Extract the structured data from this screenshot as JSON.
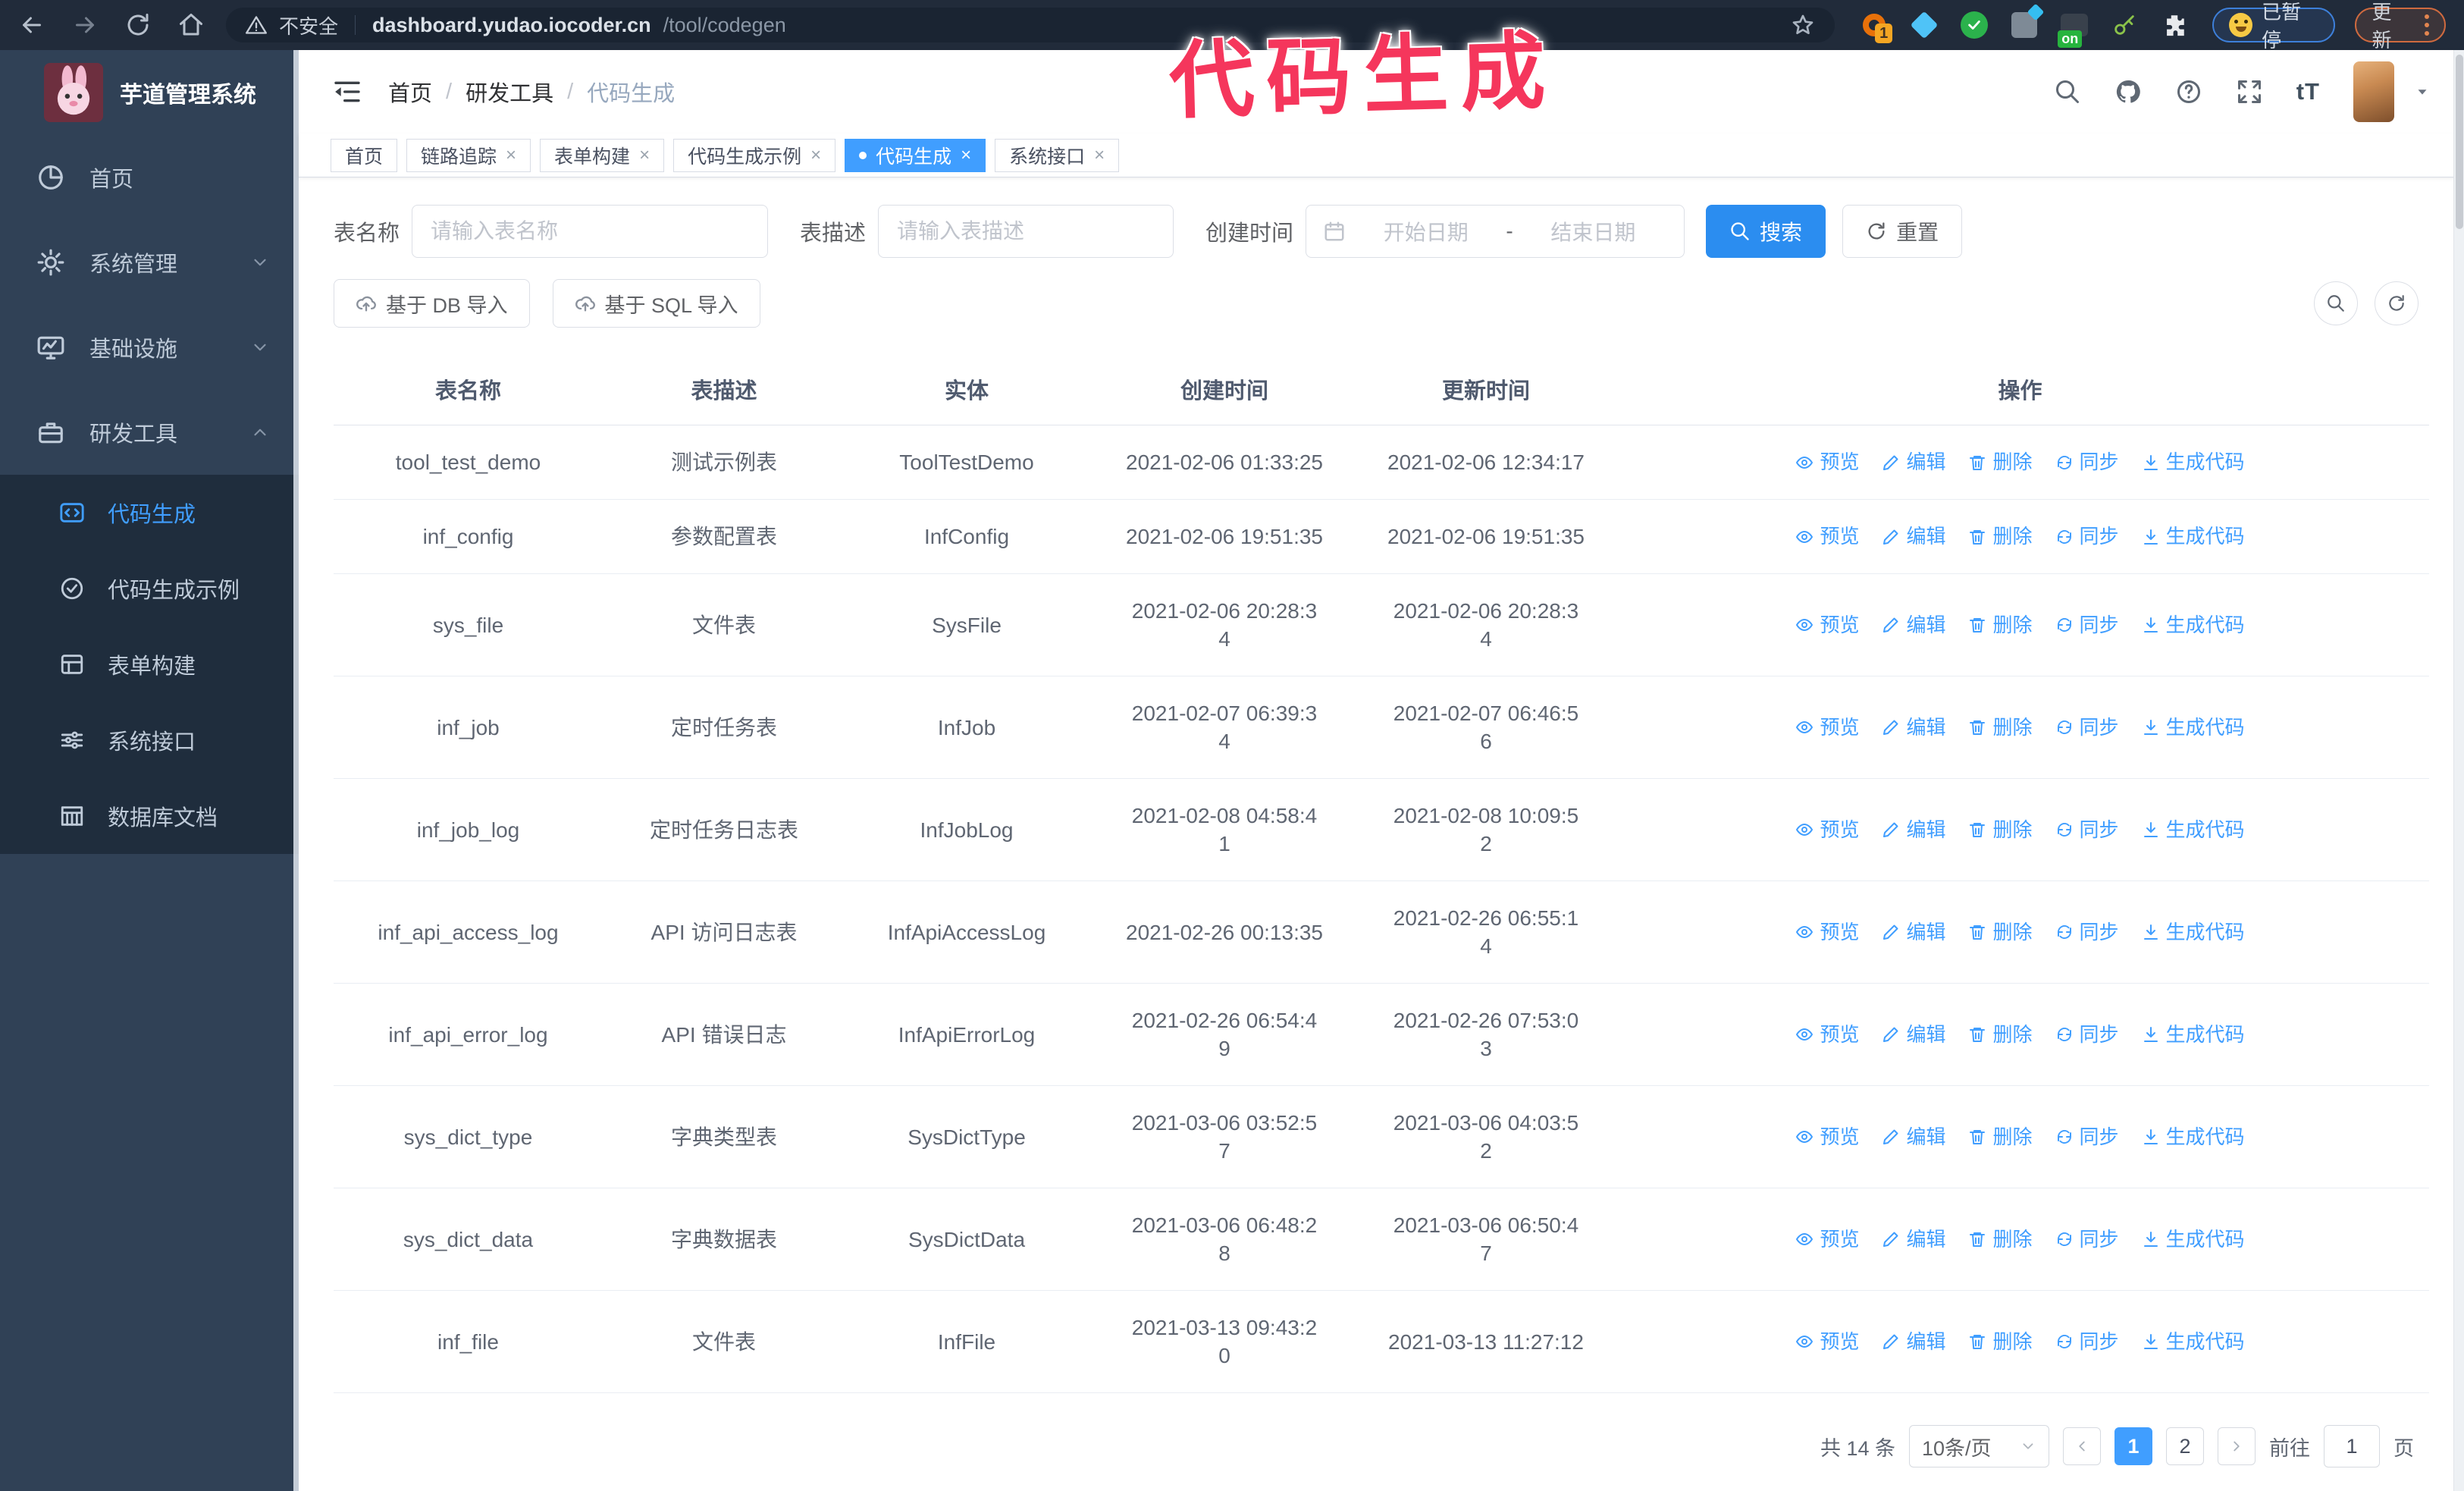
{
  "browser": {
    "security_label": "不安全",
    "url_host": "dashboard.yudao.iocoder.cn",
    "url_path": "/tool/codegen",
    "ext_badge": "1",
    "ext_on_label": "on",
    "paused_label": "已暂停",
    "update_label": "更新"
  },
  "overlay": {
    "text": "代码生成",
    "color": "#f5365c"
  },
  "sidebar": {
    "title": "芋道管理系统",
    "items": [
      {
        "label": "首页",
        "icon": "dashboard-icon"
      },
      {
        "label": "系统管理",
        "icon": "gear-icon",
        "state": "collapsed"
      },
      {
        "label": "基础设施",
        "icon": "monitor-icon",
        "state": "collapsed"
      },
      {
        "label": "研发工具",
        "icon": "briefcase-icon",
        "state": "expanded"
      }
    ],
    "sub": [
      {
        "label": "代码生成",
        "icon": "code-icon",
        "active": true
      },
      {
        "label": "代码生成示例",
        "icon": "example-icon",
        "active": false
      },
      {
        "label": "表单构建",
        "icon": "form-icon",
        "active": false
      },
      {
        "label": "系统接口",
        "icon": "api-icon",
        "active": false
      },
      {
        "label": "数据库文档",
        "icon": "dbdoc-icon",
        "active": false
      }
    ]
  },
  "breadcrumb": {
    "items": [
      "首页",
      "研发工具",
      "代码生成"
    ],
    "sep": "/"
  },
  "tabs": [
    {
      "label": "首页",
      "closable": false,
      "active": false
    },
    {
      "label": "链路追踪",
      "closable": true,
      "active": false
    },
    {
      "label": "表单构建",
      "closable": true,
      "active": false
    },
    {
      "label": "代码生成示例",
      "closable": true,
      "active": false
    },
    {
      "label": "代码生成",
      "closable": true,
      "active": true
    },
    {
      "label": "系统接口",
      "closable": true,
      "active": false
    }
  ],
  "close_glyph": "×",
  "filters": {
    "table_name_label": "表名称",
    "table_name_placeholder": "请输入表名称",
    "table_desc_label": "表描述",
    "table_desc_placeholder": "请输入表描述",
    "create_time_label": "创建时间",
    "date_start_placeholder": "开始日期",
    "date_separator": "-",
    "date_end_placeholder": "结束日期",
    "search_label": "搜索",
    "reset_label": "重置"
  },
  "toolbar": {
    "import_db_label": "基于 DB 导入",
    "import_sql_label": "基于 SQL 导入"
  },
  "table": {
    "columns": [
      "表名称",
      "表描述",
      "实体",
      "创建时间",
      "更新时间",
      "操作"
    ],
    "actions": [
      "预览",
      "编辑",
      "删除",
      "同步",
      "生成代码"
    ],
    "rows": [
      {
        "name": "tool_test_demo",
        "desc": "测试示例表",
        "entity": "ToolTestDemo",
        "created": "2021-02-06 01:33:25",
        "updated": "2021-02-06 12:34:17"
      },
      {
        "name": "inf_config",
        "desc": "参数配置表",
        "entity": "InfConfig",
        "created": "2021-02-06 19:51:35",
        "updated": "2021-02-06 19:51:35"
      },
      {
        "name": "sys_file",
        "desc": "文件表",
        "entity": "SysFile",
        "created": "2021-02-06 20:28:3\n4",
        "updated": "2021-02-06 20:28:3\n4"
      },
      {
        "name": "inf_job",
        "desc": "定时任务表",
        "entity": "InfJob",
        "created": "2021-02-07 06:39:3\n4",
        "updated": "2021-02-07 06:46:5\n6"
      },
      {
        "name": "inf_job_log",
        "desc": "定时任务日志表",
        "entity": "InfJobLog",
        "created": "2021-02-08 04:58:4\n1",
        "updated": "2021-02-08 10:09:5\n2"
      },
      {
        "name": "inf_api_access_log",
        "desc": "API 访问日志表",
        "entity": "InfApiAccessLog",
        "created": "2021-02-26 00:13:35",
        "updated": "2021-02-26 06:55:1\n4"
      },
      {
        "name": "inf_api_error_log",
        "desc": "API 错误日志",
        "entity": "InfApiErrorLog",
        "created": "2021-02-26 06:54:4\n9",
        "updated": "2021-02-26 07:53:0\n3"
      },
      {
        "name": "sys_dict_type",
        "desc": "字典类型表",
        "entity": "SysDictType",
        "created": "2021-03-06 03:52:5\n7",
        "updated": "2021-03-06 04:03:5\n2"
      },
      {
        "name": "sys_dict_data",
        "desc": "字典数据表",
        "entity": "SysDictData",
        "created": "2021-03-06 06:48:2\n8",
        "updated": "2021-03-06 06:50:4\n7"
      },
      {
        "name": "inf_file",
        "desc": "文件表",
        "entity": "InfFile",
        "created": "2021-03-13 09:43:2\n0",
        "updated": "2021-03-13 11:27:12"
      }
    ]
  },
  "pagination": {
    "total_text": "共 14 条",
    "page_size": "10条/页",
    "pages": [
      "1",
      "2"
    ],
    "active_page": "1",
    "goto_label": "前往",
    "goto_value": "1",
    "goto_suffix": "页"
  },
  "colors": {
    "accent": "#409eff",
    "sidebar_bg": "#304156",
    "submenu_bg": "#1f2d3d",
    "chrome_bg": "#212b3a",
    "overlay_red": "#f5365c"
  },
  "icons": [
    "back-icon",
    "forward-icon",
    "reload-icon",
    "home-icon",
    "warning-icon",
    "star-icon",
    "search-icon",
    "github-icon",
    "help-icon",
    "fullscreen-icon",
    "font-size-icon",
    "hamburger-icon",
    "calendar-icon",
    "refresh-icon",
    "cloud-upload-icon",
    "eye-icon",
    "edit-icon",
    "delete-icon",
    "sync-icon",
    "download-icon",
    "chevron-down-icon",
    "caret-down-icon",
    "dashboard-icon",
    "gear-icon",
    "monitor-icon",
    "briefcase-icon",
    "code-icon",
    "example-icon",
    "form-icon",
    "api-icon",
    "dbdoc-icon"
  ]
}
